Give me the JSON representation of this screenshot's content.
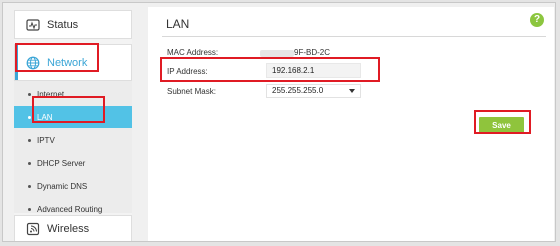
{
  "sidebar": {
    "status": {
      "label": "Status",
      "icon": "activity-monitor-icon"
    },
    "network": {
      "label": "Network",
      "icon": "globe-icon"
    },
    "submenu": [
      {
        "label": "Internet"
      },
      {
        "label": "LAN"
      },
      {
        "label": "IPTV"
      },
      {
        "label": "DHCP Server"
      },
      {
        "label": "Dynamic DNS"
      },
      {
        "label": "Advanced Routing"
      }
    ],
    "wireless": {
      "label": "Wireless",
      "icon": "wireless-icon"
    }
  },
  "main": {
    "title": "LAN",
    "mac": {
      "label": "MAC Address:",
      "value": "9F-BD-2C"
    },
    "ip": {
      "label": "IP Address:",
      "value": "192.168.2.1"
    },
    "subnet": {
      "label": "Subnet Mask:",
      "value": "255.255.255.0"
    },
    "save_label": "Save"
  },
  "help_label": "?",
  "colors": {
    "accent": "#3aa5d6",
    "active_submenu": "#52c2e6",
    "save_button": "#8fc43c",
    "highlight": "#e01b24"
  }
}
